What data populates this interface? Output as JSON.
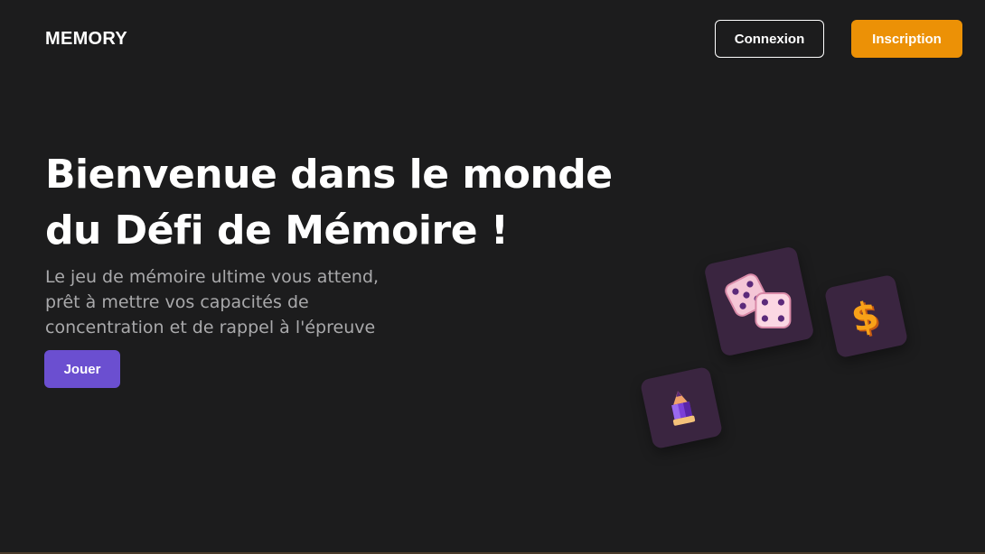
{
  "header": {
    "logo": "MEMORY",
    "login_label": "Connexion",
    "signup_label": "Inscription"
  },
  "hero": {
    "title_line1": "Bienvenue dans le monde",
    "title_line2": "du Défi de Mémoire !",
    "subtitle_line1": "Le jeu de mémoire ultime vous attend,",
    "subtitle_line2": "prêt à mettre vos capacités de",
    "subtitle_line3": "concentration et de rappel à l'épreuve",
    "play_label": "Jouer"
  },
  "tiles": [
    {
      "icon": "dice-icon"
    },
    {
      "icon": "dollar-icon"
    },
    {
      "icon": "pencil-gem-icon"
    }
  ],
  "colors": {
    "background": "#1c1c1d",
    "signup": "#ec9106",
    "play": "#6b4fd0",
    "tile": "#3a2540"
  }
}
